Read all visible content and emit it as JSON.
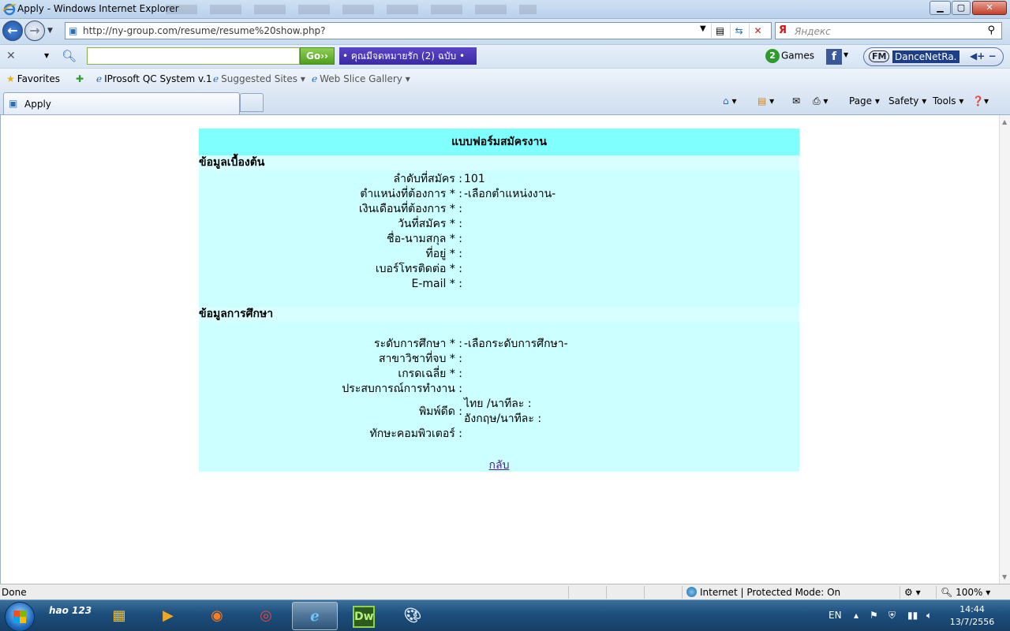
{
  "window": {
    "title": "Apply - Windows Internet Explorer",
    "minimize": "▁",
    "maximize": "▢",
    "close": "✕"
  },
  "address": {
    "url": "http://ny-group.com/resume/resume%20show.php?",
    "search_placeholder": "Яндекс"
  },
  "toolbar": {
    "go_label": "Go››",
    "banner_text": "• คุณมีจดหมายรัก (2) ฉบับ •",
    "games_label": "Games",
    "radio_badge": "FM",
    "radio_name": "DanceNetRa.",
    "radio_controls": "◀+ −"
  },
  "favorites": {
    "label": "Favorites",
    "items": [
      {
        "label": "IProsoft QC System v.1"
      },
      {
        "label": "Suggested Sites ▾"
      },
      {
        "label": "Web Slice Gallery ▾"
      }
    ]
  },
  "tabs": {
    "active_label": "Apply"
  },
  "commands": {
    "page": "Page ▾",
    "safety": "Safety ▾",
    "tools": "Tools ▾"
  },
  "form": {
    "title": "แบบฟอร์มสมัครงาน",
    "section_basic": "ข้อมูลเบื้องต้น",
    "section_edu": "ข้อมูลการศึกษา",
    "basic_rows": [
      {
        "label": "ลำดับที่สมัคร :",
        "value": "101"
      },
      {
        "label": "ตำแหน่งที่ต้องการ * :",
        "value": "-เลือกตำแหน่งงาน-"
      },
      {
        "label": "เงินเดือนที่ต้องการ * :",
        "value": ""
      },
      {
        "label": "วันที่สมัคร * :",
        "value": ""
      },
      {
        "label": "ชื่อ-นามสกุล * :",
        "value": ""
      },
      {
        "label": "ที่อยู่ * :",
        "value": ""
      },
      {
        "label": "เบอร์โทรติดต่อ * :",
        "value": ""
      },
      {
        "label": "E-mail * :",
        "value": ""
      }
    ],
    "edu_rows": [
      {
        "label": "ระดับการศึกษา * :",
        "value": "-เลือกระดับการศึกษา-"
      },
      {
        "label": "สาขาวิชาที่จบ * :",
        "value": ""
      },
      {
        "label": "เกรดเฉลี่ย * :",
        "value": ""
      },
      {
        "label": "ประสบการณ์การทำงาน :",
        "value": ""
      }
    ],
    "typing_label": "พิมพ์ดีด :",
    "typing_thai": "ไทย /นาทีละ :",
    "typing_eng": "อังกฤษ/นาทีละ :",
    "computer_label": "ทักษะคอมพิวเตอร์ :",
    "back_link": "กลับ"
  },
  "status": {
    "text": "Done",
    "zone": "Internet | Protected Mode: On",
    "zoom": "100%"
  },
  "taskbar": {
    "hao_label": "hao 123",
    "dw_label": "Dw",
    "lang": "EN",
    "time": "14:44",
    "date": "13/7/2556"
  }
}
